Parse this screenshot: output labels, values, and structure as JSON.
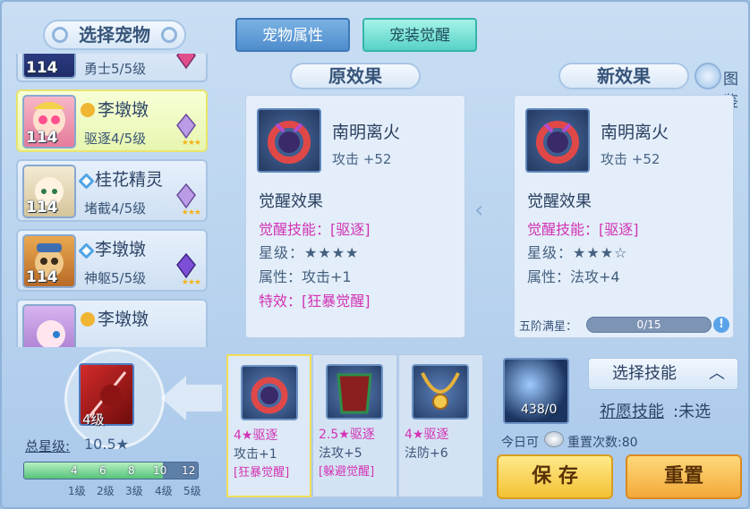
{
  "left": {
    "title": "选择宠物",
    "pets": [
      {
        "level": "114",
        "name": "",
        "sub": "勇士5/5级",
        "icon": "none",
        "selected": false
      },
      {
        "level": "114",
        "name": "李墩墩",
        "sub": "驱逐4/5级",
        "icon": "info-icon",
        "selected": true
      },
      {
        "level": "114",
        "name": "桂花精灵",
        "sub": "堵截4/5级",
        "icon": "diamond-icon",
        "selected": false
      },
      {
        "level": "114",
        "name": "李墩墩",
        "sub": "神躯5/5级",
        "icon": "diamond-icon",
        "selected": false
      },
      {
        "level": "",
        "name": "李墩墩",
        "sub": "",
        "icon": "info-icon",
        "selected": false
      }
    ],
    "weapon_level": "4级",
    "total_star_label": "总星级:",
    "total_star_value": "10.5★",
    "star_scale_numbers": [
      "4",
      "6",
      "8",
      "10",
      "12"
    ],
    "star_scale_levels": [
      "1级",
      "2级",
      "3级",
      "4级",
      "5级"
    ],
    "star_scale_fill": 0.8
  },
  "tabs": {
    "attr": "宠物属性",
    "awaken": "宠装觉醒"
  },
  "original": {
    "header": "原效果",
    "equip_name": "南明离火",
    "equip_stat": "攻击 +52",
    "awaken_title": "觉醒效果",
    "skill_line": "觉醒技能：[驱逐]",
    "star_line": "星级：★★★★",
    "attr_line": "属性：攻击+1",
    "special_line": "特效：[狂暴觉醒]"
  },
  "new": {
    "header": "新效果",
    "equip_name": "南明离火",
    "equip_stat": "攻击 +52",
    "awaken_title": "觉醒效果",
    "skill_line": "觉醒技能：[驱逐]",
    "star_line": "星级：★★★☆",
    "attr_line": "属性：法攻+4",
    "progress_label": "五阶满星：",
    "progress_value": "0/15",
    "progress_fraction": 0,
    "guide_label": "图鉴"
  },
  "candidates": [
    {
      "line1": "4★驱逐",
      "line2": "攻击+1",
      "line3": "[狂暴觉醒]",
      "selected": true
    },
    {
      "line1": "2.5★驱逐",
      "line2": "法攻+5",
      "line3": "[躲避觉醒]",
      "selected": false
    },
    {
      "line1": "4★驱逐",
      "line2": "法防+6",
      "line3": "",
      "selected": false
    }
  ],
  "right": {
    "orb_count": "438/0",
    "select_skill_label": "选择技能",
    "wish_label": "祈愿技能",
    "wish_value": ":未选",
    "today_label": "今日可",
    "reset_count": "重置次数:80",
    "save_label": "保 存",
    "reset_label": "重置"
  },
  "colors": {
    "pink": "#d233b4",
    "accent": "#57d2c7",
    "save": "#f3c235"
  }
}
